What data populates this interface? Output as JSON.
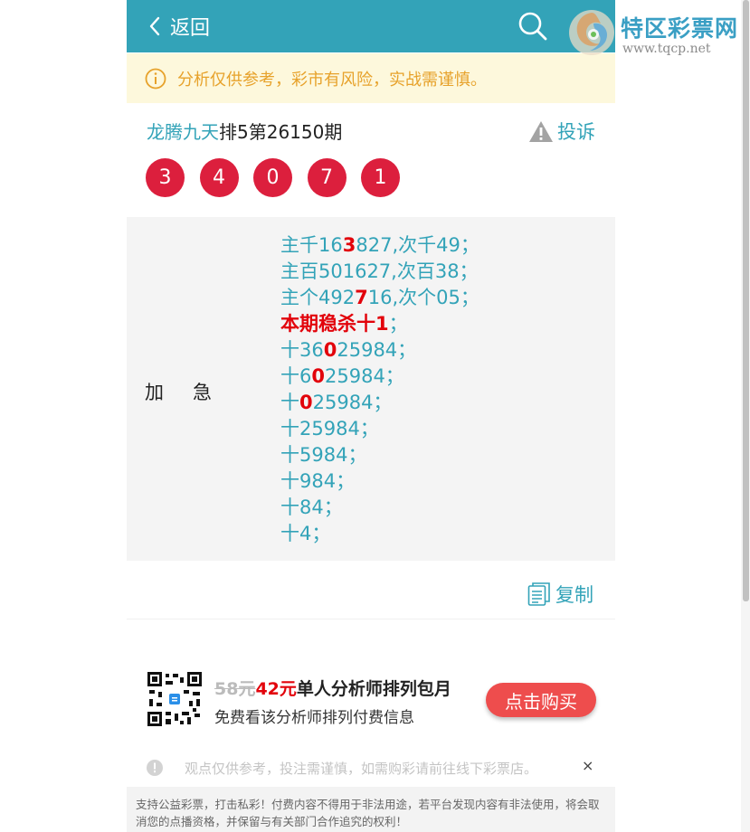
{
  "header": {
    "back_label": "返回",
    "back_icon": "chevron-left-icon",
    "search_icon": "search-icon",
    "bg_color": "#33a3b8"
  },
  "watermark": {
    "name": "特区彩票网",
    "url": "www.tqcp.net"
  },
  "notice": {
    "text": "分析仅供参考，彩市有风险，实战需谨慎。",
    "icon": "info-icon",
    "color": "#e7a22b"
  },
  "lottery": {
    "expert": "龙腾九天",
    "issue": "排5第26150期",
    "complain_label": "投诉",
    "balls": [
      "3",
      "4",
      "0",
      "7",
      "1"
    ],
    "ball_color": "#dc1f3d"
  },
  "prediction": {
    "label_a": "加",
    "label_b": "急",
    "lines": [
      [
        {
          "t": "主千16"
        },
        {
          "t": "3",
          "hl": true
        },
        {
          "t": "827,次千49；"
        }
      ],
      [
        {
          "t": "主百501627,次百38；"
        }
      ],
      [
        {
          "t": "主个492"
        },
        {
          "t": "7",
          "hl": true
        },
        {
          "t": "16,次个05；"
        }
      ],
      [
        {
          "t": "本期稳杀十1",
          "hl": true
        },
        {
          "t": "；"
        }
      ],
      [
        {
          "t": "十36"
        },
        {
          "t": "0",
          "hl": true
        },
        {
          "t": "25984；"
        }
      ],
      [
        {
          "t": "十6"
        },
        {
          "t": "0",
          "hl": true
        },
        {
          "t": "25984；"
        }
      ],
      [
        {
          "t": "十"
        },
        {
          "t": "0",
          "hl": true
        },
        {
          "t": "25984；"
        }
      ],
      [
        {
          "t": "十25984；"
        }
      ],
      [
        {
          "t": "十5984；"
        }
      ],
      [
        {
          "t": "十984；"
        }
      ],
      [
        {
          "t": "十84；"
        }
      ],
      [
        {
          "t": "十4；"
        }
      ]
    ]
  },
  "copy_label": "复制",
  "promo": {
    "old_price": "58元",
    "new_price": "42元",
    "title": "单人分析师排列包月",
    "subtitle": "免费看该分析师排列付费信息",
    "button_label": "点击购买",
    "button_color": "#ee4d4d"
  },
  "disclaimer": {
    "text": "观点仅供参考，投注需谨慎，如需购彩请前往线下彩票店。",
    "close": "×"
  },
  "footer": {
    "text": "支持公益彩票，打击私彩！付费内容不得用于非法用途，若平台发现内容有非法使用，将会取消您的点播资格，并保留与有关部门合作追究的权利！"
  }
}
